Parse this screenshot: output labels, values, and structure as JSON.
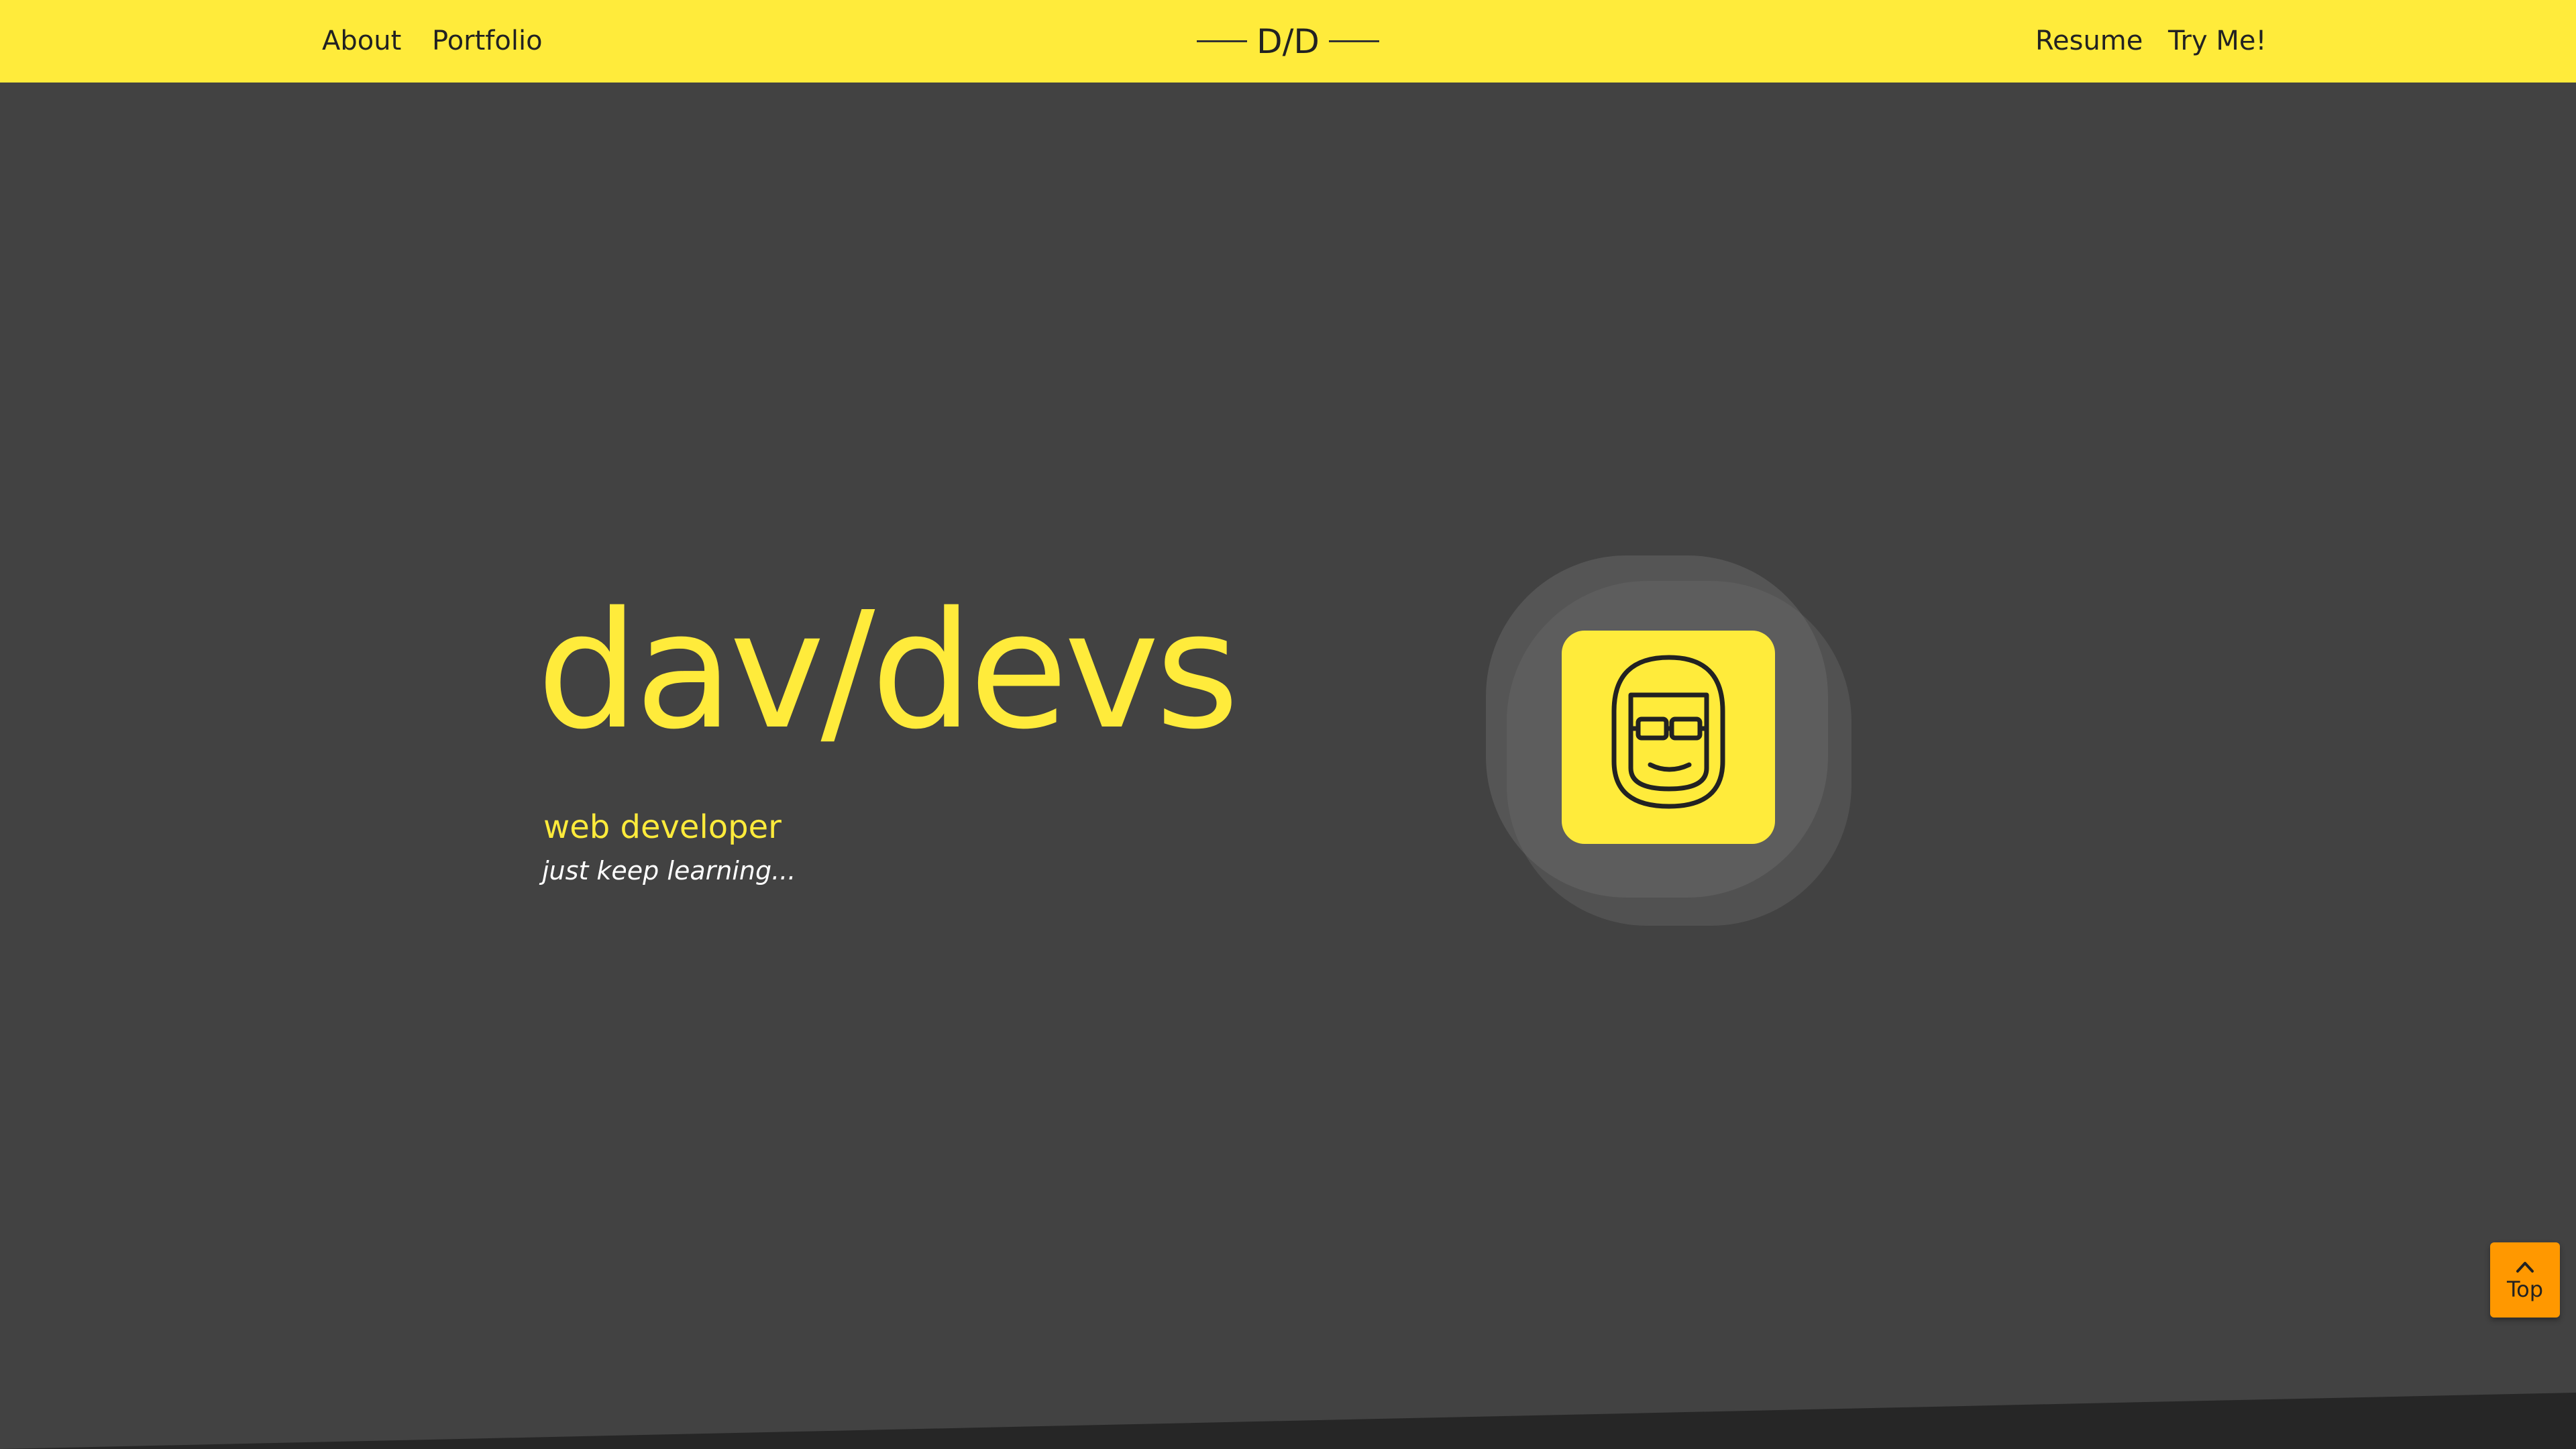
{
  "nav": {
    "left_links": [
      "About",
      "Portfolio"
    ],
    "brand": "D/D",
    "right_links": [
      "Resume",
      "Try Me!"
    ]
  },
  "hero": {
    "title": "dav/devs",
    "role": "web developer",
    "tagline": "just keep learning..."
  },
  "avatar": {
    "icon": "developer-avatar-icon"
  },
  "scroll_top": {
    "label": "Top",
    "icon": "chevron-up-icon"
  },
  "colors": {
    "accent": "#ffeb3b",
    "background": "#424242",
    "footer": "#262626",
    "top_button": "#ff9800",
    "nav_text": "#222222"
  }
}
